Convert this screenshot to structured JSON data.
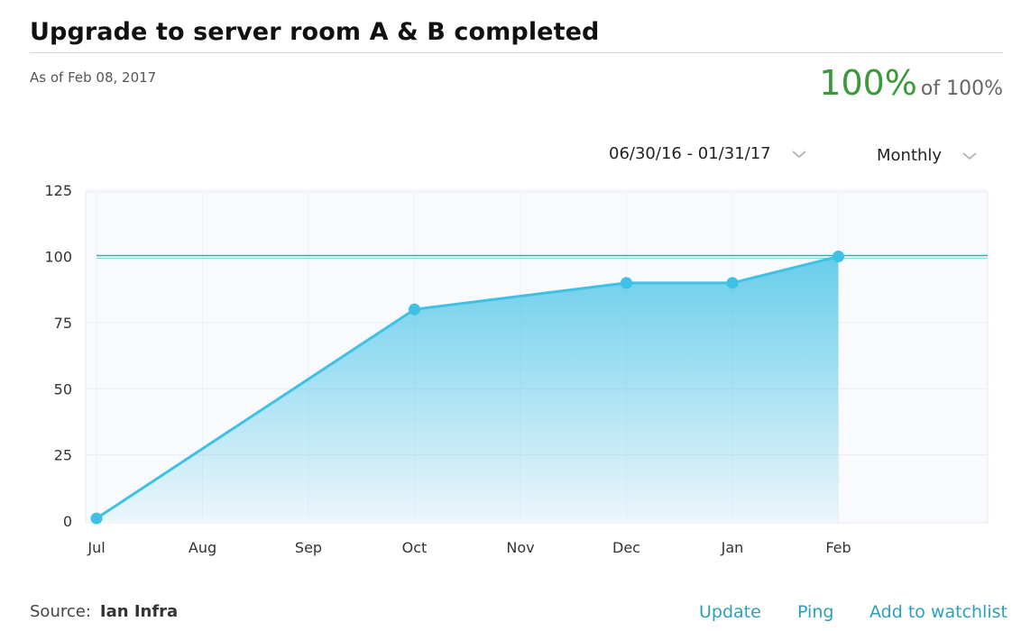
{
  "header": {
    "title": "Upgrade to server room A & B completed",
    "as_of": "As of Feb 08, 2017",
    "progress_value": "100%",
    "progress_of": "of 100%",
    "progress_color": "#3a9a3a"
  },
  "controls": {
    "date_range": "06/30/16 - 01/31/17",
    "period": "Monthly"
  },
  "footer": {
    "source_label": "Source:",
    "source_name": "Ian Infra",
    "links": {
      "update": "Update",
      "ping": "Ping",
      "watchlist": "Add to watchlist"
    }
  },
  "chart_data": {
    "type": "area",
    "categories": [
      "Jul",
      "Aug",
      "Sep",
      "Oct",
      "Nov",
      "Dec",
      "Jan",
      "Feb"
    ],
    "ylim": [
      0,
      125
    ],
    "yticks": [
      0,
      25,
      50,
      75,
      100,
      125
    ],
    "target": 100,
    "series": [
      {
        "points": [
          {
            "x": "Jul",
            "y": 1
          },
          {
            "x": "Oct",
            "y": 80
          },
          {
            "x": "Dec",
            "y": 90
          },
          {
            "x": "Jan",
            "y": 90
          },
          {
            "x": "Feb",
            "y": 100
          }
        ],
        "color": "#3fc1e6"
      }
    ],
    "grid": true,
    "legend": "none"
  }
}
